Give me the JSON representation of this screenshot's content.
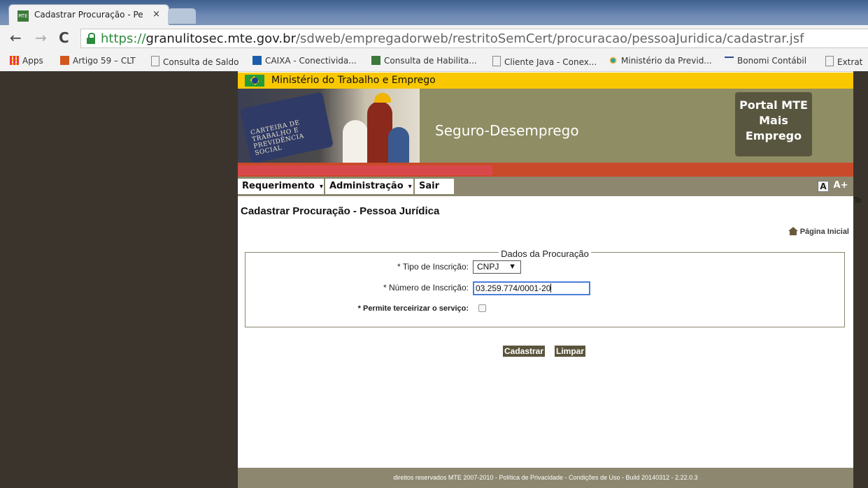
{
  "browser": {
    "tab": {
      "title": "Cadastrar Procuração - Pe",
      "close": "×",
      "favicon_text": "MTE"
    },
    "nav": {
      "back": "←",
      "forward": "→",
      "reload": "C"
    },
    "url": {
      "scheme": "https://",
      "host": "granulitosec.mte.gov.br",
      "path": "/sdweb/empregadorweb/restritoSemCert/procuracao/pessoaJuridica/cadastrar.jsf"
    },
    "bookmarks": [
      {
        "label": "Apps",
        "icon": "apps-grid-icon"
      },
      {
        "label": "Artigo 59 – CLT",
        "icon": "bookmark-favicon-icon"
      },
      {
        "label": "Consulta de Saldo",
        "icon": "page-icon"
      },
      {
        "label": "CAIXA - Conectivida...",
        "icon": "caixa-icon"
      },
      {
        "label": "Consulta de Habilita...",
        "icon": "mte-icon"
      },
      {
        "label": "Cliente Java - Conex...",
        "icon": "page-icon"
      },
      {
        "label": "Ministério da Previd...",
        "icon": "previdencia-icon"
      },
      {
        "label": "Bonomi Contábil",
        "icon": "bonomi-icon"
      },
      {
        "label": "Extrat",
        "icon": "page-icon"
      }
    ],
    "colors": {
      "secure": "#2e8b3e"
    }
  },
  "site": {
    "ministry": "Ministério do Trabalho e Emprego",
    "banner_title": "Seguro-Desemprego",
    "portal_lines": [
      "Portal MTE",
      "Mais",
      "Emprego"
    ],
    "card_text": "CARTEIRA DE TRABALHO E PREVIDÊNCIA SOCIAL",
    "menu": [
      {
        "label": "Requerimento",
        "caret": "▾"
      },
      {
        "label": "Administração",
        "caret": "▾"
      },
      {
        "label": "Sair"
      }
    ],
    "font_controls": [
      "A",
      "A+"
    ],
    "edge_text": "To",
    "colors": {
      "yellow": "#f9c800",
      "olive": "#8c876e",
      "red": "#c94a2a",
      "dark": "#3a342d",
      "button": "#5a543c"
    }
  },
  "form": {
    "page_title": "Cadastrar Procuração - Pessoa Jurídica",
    "home_link": "Página Inicial",
    "legend": "Dados da Procuração",
    "tipo_label": "* Tipo de Inscrição:",
    "tipo_value": "CNPJ",
    "tipo_arrow": "▼",
    "numero_label": "* Número de Inscrição:",
    "numero_value": "03.259.774/0001-20",
    "terceirizar_label": "* Permite terceirizar o serviço:",
    "terceirizar_checked": false,
    "submit_label": "Cadastrar",
    "clear_label": "Limpar"
  },
  "footer": {
    "text": "direitos reservados MTE 2007-2010 - Política de Privacidade - Condições de Uso - Build 20140312 - 2.22.0.3"
  }
}
